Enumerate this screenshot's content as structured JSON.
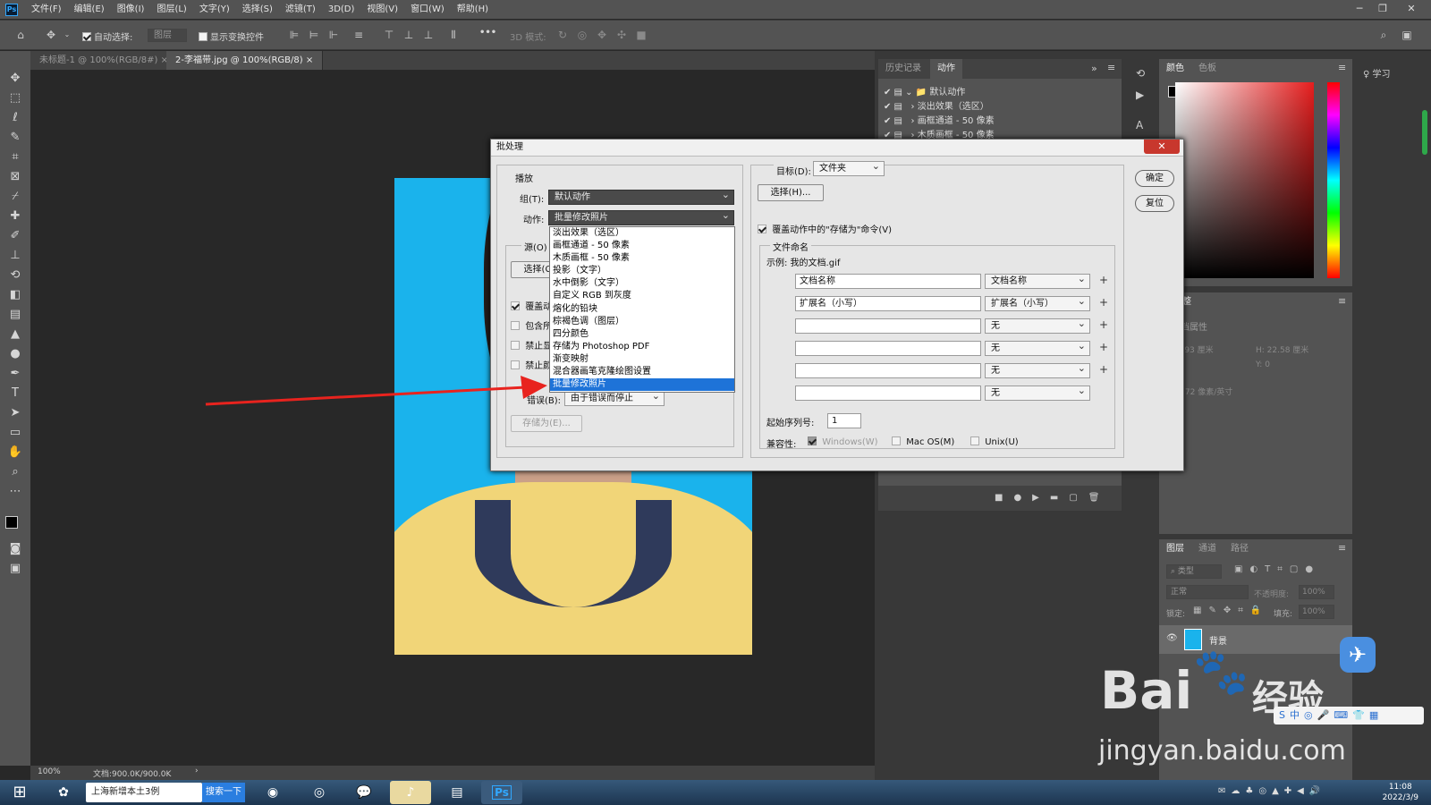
{
  "menubar": {
    "logo": "Ps",
    "items": [
      "文件(F)",
      "编辑(E)",
      "图像(I)",
      "图层(L)",
      "文字(Y)",
      "选择(S)",
      "滤镜(T)",
      "3D(D)",
      "视图(V)",
      "窗口(W)",
      "帮助(H)"
    ]
  },
  "options": {
    "auto_select_label": "自动选择:",
    "auto_select_value": "图层",
    "show_transform_label": "显示变换控件",
    "mode_3d_label": "3D 模式:",
    "more": "•••"
  },
  "doc_tabs": [
    {
      "label": "未标题-1 @ 100%(RGB/8#)"
    },
    {
      "label": "2-李福带.jpg @ 100%(RGB/8)"
    }
  ],
  "status": {
    "zoom": "100%",
    "doc": "文档:900.0K/900.0K"
  },
  "history_panel": {
    "tabs": [
      "历史记录",
      "动作"
    ],
    "rows": [
      "默认动作",
      "淡出效果（选区）",
      "画框通道 - 50 像素",
      "木质画框 - 50 像素"
    ]
  },
  "color_panel": {
    "tabs": [
      "颜色",
      "色板"
    ]
  },
  "learn_label": "学习",
  "adjust_panel": {
    "tab": "调整",
    "doc_props": "文档属性",
    "w": "16.93 厘米",
    "h": "H: 22.58 厘米",
    "x": "0",
    "y": "Y: 0",
    "res": "率: 72 像素/英寸"
  },
  "layers_panel": {
    "tabs": [
      "图层",
      "通道",
      "路径"
    ],
    "kind_filter": "类型",
    "blend": "正常",
    "opacity_label": "不透明度:",
    "opacity": "100%",
    "lock_label": "锁定:",
    "fill_label": "填充:",
    "fill": "100%",
    "layer_name": "背景"
  },
  "dialog": {
    "title": "批处理",
    "play": {
      "title": "播放",
      "group_label": "组(T):",
      "group_value": "默认动作",
      "action_label": "动作:",
      "action_value": "批量修改照片"
    },
    "source": {
      "label": "源(O)",
      "choose_btn": "选择(C",
      "opt1": "覆盖动",
      "opt2": "包含所",
      "opt3": "禁止显",
      "opt4": "禁止颜"
    },
    "error_label": "错误(B):",
    "error_value": "由于错误而停止",
    "save_as_btn": "存储为(E)...",
    "dest_label": "目标(D):",
    "dest_value": "文件夹",
    "dest_choose_btn": "选择(H)...",
    "override_save": "覆盖动作中的\"存储为\"命令(V)",
    "naming_title": "文件命名",
    "example": "示例: 我的文档.gif",
    "naming_rows": [
      {
        "text": "文档名称",
        "select": "文档名称",
        "plus": "+"
      },
      {
        "text": "扩展名（小写）",
        "select": "扩展名（小写）",
        "plus": "+"
      },
      {
        "text": "",
        "select": "无",
        "plus": "+"
      },
      {
        "text": "",
        "select": "无",
        "plus": "+"
      },
      {
        "text": "",
        "select": "无",
        "plus": "+"
      },
      {
        "text": "",
        "select": "无",
        "plus": ""
      }
    ],
    "start_serial_label": "起始序列号:",
    "start_serial_value": "1",
    "compat_label": "兼容性:",
    "compat_windows": "Windows(W)",
    "compat_mac": "Mac OS(M)",
    "compat_unix": "Unix(U)",
    "ok_btn": "确定",
    "reset_btn": "复位",
    "close": "✕",
    "action_options": [
      "淡出效果（选区）",
      "画框通道 - 50 像素",
      "木质画框 - 50 像素",
      "投影（文字）",
      "水中倒影（文字）",
      "自定义 RGB 到灰度",
      "熔化的铅块",
      "棕褐色调（图层）",
      "四分颜色",
      "存储为 Photoshop PDF",
      "渐变映射",
      "混合器画笔克隆绘图设置",
      "批量修改照片"
    ],
    "selected_index": 12
  },
  "taskbar": {
    "search_text": "上海新增本土3例",
    "search_btn": "搜索一下",
    "time": "11:08",
    "date": "2022/3/9"
  },
  "watermark": {
    "brand": "Bai",
    "brand2": "经验",
    "url": "jingyan.baidu.com"
  },
  "colors": {
    "accent": "#1e73d8",
    "ps_blue": "#31a8ff",
    "photo_bg": "#1ab3ec",
    "arrow": "#e8231e"
  }
}
